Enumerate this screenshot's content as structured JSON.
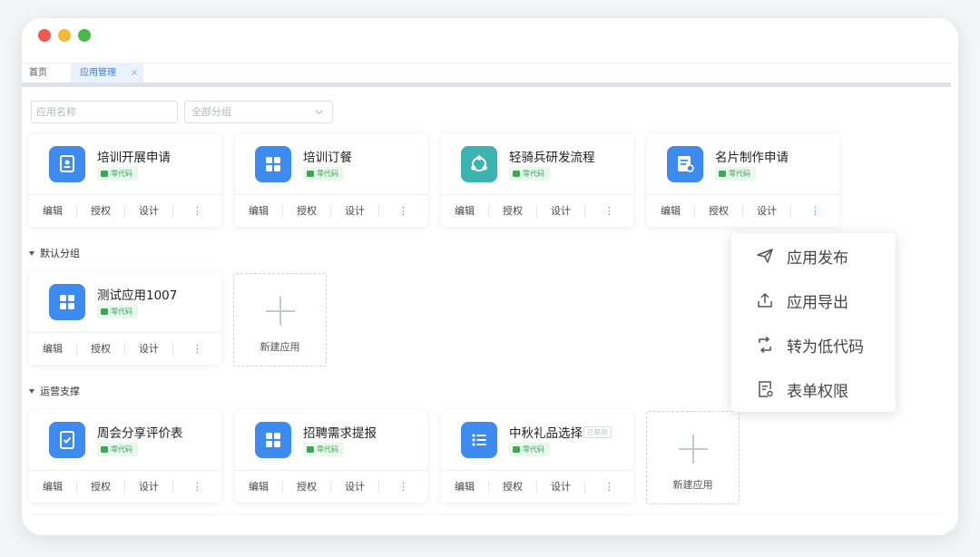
{
  "window": {
    "tabs": [
      {
        "label": "首页"
      },
      {
        "label": "应用管理",
        "close": "×"
      }
    ]
  },
  "filters": {
    "name_placeholder": "应用名称",
    "group_value": "全部分组"
  },
  "badge_text": "零代码",
  "actions": {
    "edit": "编辑",
    "auth": "授权",
    "design": "设计",
    "more": "⋮"
  },
  "cards_top": [
    {
      "title": "培训开展申请"
    },
    {
      "title": "培训订餐"
    },
    {
      "title": "轻骑兵研发流程"
    },
    {
      "title": "名片制作申请"
    }
  ],
  "sections": [
    {
      "label": "默认分组"
    },
    {
      "label": "运营支撑"
    }
  ],
  "cards_default": [
    {
      "title": "测试应用1007"
    }
  ],
  "cards_ops": [
    {
      "title": "周会分享评价表"
    },
    {
      "title": "招聘需求提报"
    },
    {
      "title": "中秋礼品选择",
      "tag": "已禁用"
    }
  ],
  "new_app_label": "新建应用",
  "popup_menu": [
    {
      "label": "应用发布",
      "icon": "send-icon"
    },
    {
      "label": "应用导出",
      "icon": "export-icon"
    },
    {
      "label": "转为低代码",
      "icon": "convert-icon"
    },
    {
      "label": "表单权限",
      "icon": "form-permission-icon"
    }
  ],
  "colors": {
    "primary": "#3d8bef",
    "teal": "#3bb3b0",
    "badge_green": "#3ea55a",
    "badge_bg": "#e9f7ec",
    "active_tab_bg": "#eaf2ff"
  }
}
